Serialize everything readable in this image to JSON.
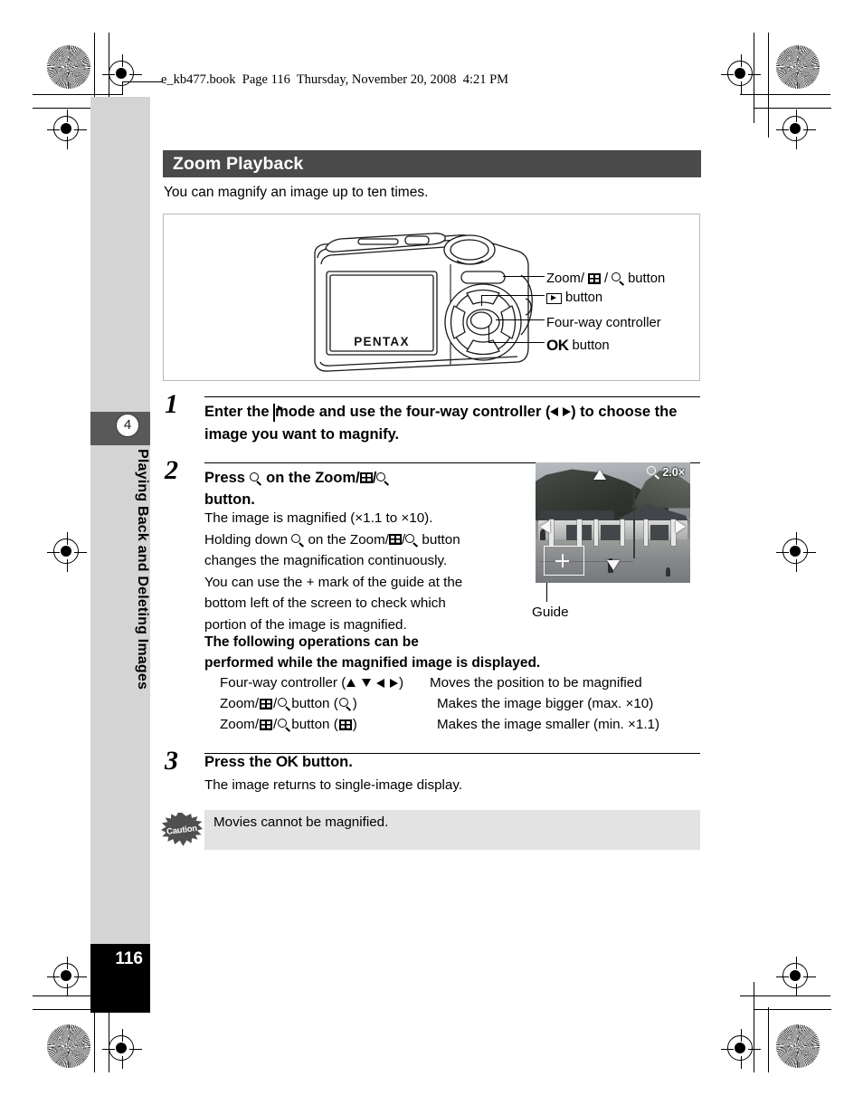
{
  "running_head": "e_kb477.book  Page 116  Thursday, November 20, 2008  4:21 PM",
  "sidebar": {
    "chapter_number": "4",
    "chapter_title": "Playing Back and Deleting Images",
    "page_number": "116"
  },
  "section": {
    "title": "Zoom Playback",
    "intro": "You can magnify an image up to ten times."
  },
  "figure": {
    "camera_brand": "PENTAX",
    "callouts": [
      {
        "prefix": "Zoom/",
        "icons": [
          "thumbnail-icon",
          "magnify-icon"
        ],
        "suffix": " button",
        "label": "Zoom/[thumb]/[mag] button"
      },
      {
        "prefix": "",
        "icons": [
          "playback-icon"
        ],
        "suffix": " button",
        "label": "[playback] button"
      },
      {
        "prefix": "Four-way controller",
        "icons": [],
        "suffix": "",
        "label": "Four-way controller"
      },
      {
        "prefix": "OK",
        "icons": [],
        "suffix": " button",
        "label": "OK button"
      }
    ]
  },
  "steps": [
    {
      "number": "1",
      "heading_parts": [
        "Enter the ",
        " mode and use the four-way controller (",
        ") to choose the image you want to magnify."
      ],
      "heading_plain": "Enter the [playback] mode and use the four-way controller ( ◀ ▶ ) to choose the image you want to magnify.",
      "body": ""
    },
    {
      "number": "2",
      "heading_plain": "Press [mag] on the Zoom/[thumb]/[mag] button.",
      "body_lines": [
        "The image is magnified (×1.1 to ×10).",
        "Holding down [mag] on the Zoom/[thumb]/[mag] button",
        "changes the magnification continuously.",
        "You can use the + mark of the guide at the",
        "bottom left of the screen to check which",
        "portion of the image is magnified."
      ],
      "body_line_1a": "The image is magnified (×1.1 to ×10).",
      "body_line_2a": "Holding down ",
      "body_line_2b": " on the Zoom/",
      "body_line_2c": " button",
      "body_line_3": "changes the magnification continuously.",
      "body_line_4": "You can use the + mark of the guide at the",
      "body_line_5": "bottom left of the screen to check which",
      "body_line_6": "portion of the image is magnified."
    },
    {
      "number": "3",
      "heading_plain": "Press the OK button.",
      "heading_pre": "Press the ",
      "heading_ok": "OK",
      "heading_post": " button.",
      "body": "The image returns to single-image display."
    }
  ],
  "operations": {
    "title_line_1": "The following operations can be",
    "title_line_2": "performed while the magnified image is displayed.",
    "rows": [
      {
        "control_pre": "Four-way controller (",
        "control_post": ")",
        "control_plain": "Four-way controller ( ▲ ▼ ◀ ▶ )",
        "action": "Moves the position to be magnified"
      },
      {
        "control_pre": "Zoom/",
        "control_mid": " button (",
        "control_post": ")",
        "control_plain": "Zoom/[thumb]/[mag] button ( [mag] )",
        "action": "Makes the image bigger (max. ×10)"
      },
      {
        "control_pre": "Zoom/",
        "control_mid": " button (",
        "control_post": ")",
        "control_plain": "Zoom/[thumb]/[mag] button ( [thumb] )",
        "action": "Makes the image smaller (min. ×1.1)"
      }
    ]
  },
  "caution": {
    "badge_label": "Caution",
    "text": "Movies cannot be magnified."
  },
  "lcd_sample": {
    "magnification": "2.0×",
    "guide_label": "Guide"
  },
  "colors": {
    "section_bar": "#4a4a4a",
    "sidebar": "#d4d4d4",
    "chapter_bar": "#595959",
    "caution_bar": "#e3e3e3",
    "page_number_bg": "#000000"
  }
}
